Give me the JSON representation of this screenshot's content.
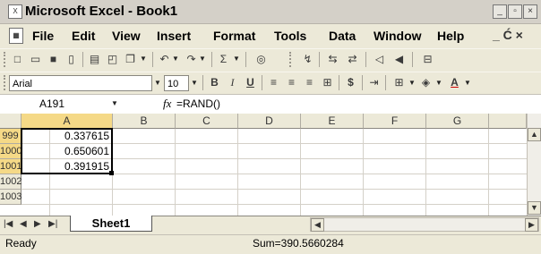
{
  "window": {
    "title": "Microsoft Excel - Book1",
    "app_icon": "excel-icon"
  },
  "menu": [
    "File",
    "Edit",
    "View",
    "Insert",
    "Format",
    "Tools",
    "Data",
    "Window",
    "Help"
  ],
  "menu_tail": "_ Ć ×",
  "toolbar_format": {
    "font": "Arial",
    "size": "10"
  },
  "formula_bar": {
    "name_box": "A191",
    "fx": "fx",
    "formula": "=RAND()"
  },
  "grid": {
    "columns": [
      "A",
      "B",
      "C",
      "D",
      "E",
      "F",
      "G",
      ""
    ],
    "rows": [
      {
        "num": "999",
        "a": "0.337615"
      },
      {
        "num": "1000",
        "a": "0.650601"
      },
      {
        "num": "1001",
        "a": "0.391915"
      },
      {
        "num": "1002",
        "a": ""
      },
      {
        "num": "1003",
        "a": ""
      }
    ]
  },
  "sheet_tabs": [
    "Sheet1"
  ],
  "status": {
    "ready": "Ready",
    "sum": "Sum=390.5660284"
  },
  "colors": {
    "chrome": "#ece9d8",
    "selection": "#000000"
  }
}
